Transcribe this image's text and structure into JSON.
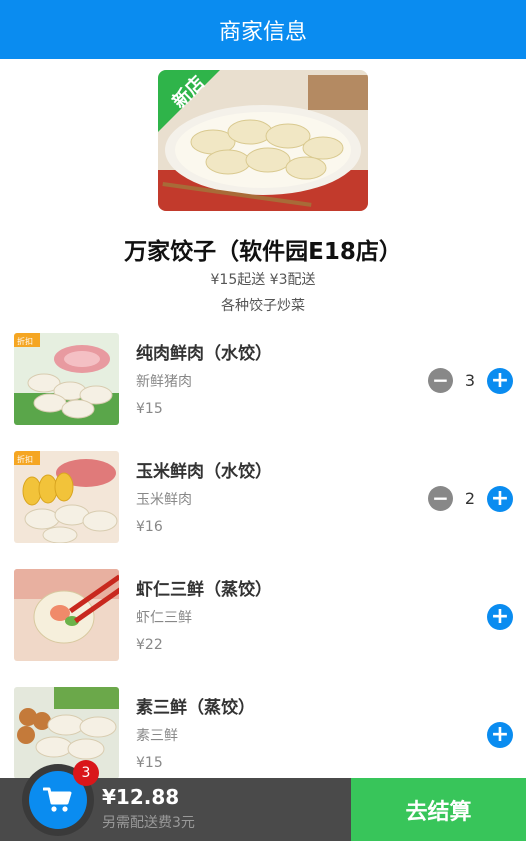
{
  "colors": {
    "accent": "#0a8cf0",
    "checkout": "#38c55a",
    "badge": "#d9161a"
  },
  "header": {
    "title": "商家信息"
  },
  "shop": {
    "image_badge": "新店",
    "name": "万家饺子（软件园E18店）",
    "delivery_info": "¥15起送 ¥3配送",
    "description": "各种饺子炒菜"
  },
  "items": [
    {
      "name": "纯肉鲜肉（水饺）",
      "desc": "新鲜猪肉",
      "price": "¥15",
      "qty": "3",
      "show_minus": true,
      "image_tag": "折扣"
    },
    {
      "name": "玉米鲜肉（水饺）",
      "desc": "玉米鲜肉",
      "price": "¥16",
      "qty": "2",
      "show_minus": true,
      "image_tag": "折扣"
    },
    {
      "name": "虾仁三鲜（蒸饺）",
      "desc": "虾仁三鲜",
      "price": "¥22",
      "qty": "",
      "show_minus": false,
      "image_tag": ""
    },
    {
      "name": "素三鲜（蒸饺）",
      "desc": "素三鲜",
      "price": "¥15",
      "qty": "",
      "show_minus": false,
      "image_tag": ""
    }
  ],
  "cart": {
    "count": "3",
    "total": "¥12.88",
    "delivery_note": "另需配送费3元",
    "checkout_label": "去结算"
  }
}
